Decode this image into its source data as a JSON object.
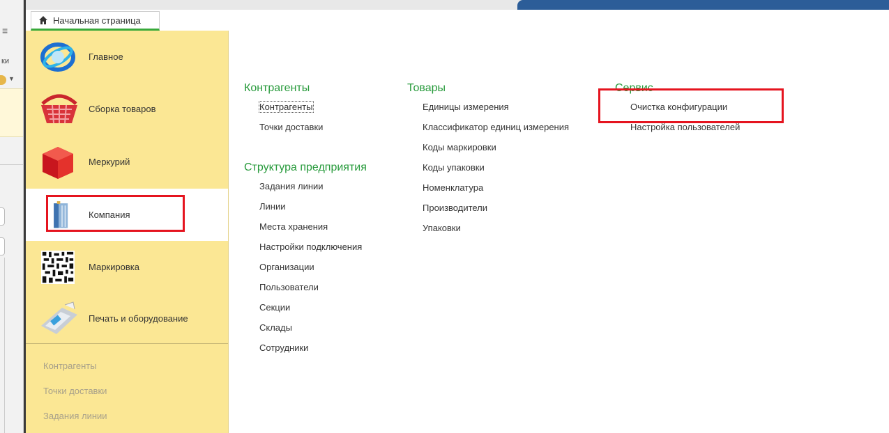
{
  "strip": {
    "menu_glyph": "≡",
    "partial_text": "ки",
    "caret": "▼"
  },
  "tab": {
    "home_icon": "home-icon",
    "label": "Начальная страница"
  },
  "sidebar": {
    "sections": [
      {
        "label": "Главное",
        "icon": "globe-icon"
      },
      {
        "label": "Сборка товаров",
        "icon": "basket-icon"
      },
      {
        "label": "Меркурий",
        "icon": "red-cube-icon"
      },
      {
        "label": "Компания",
        "icon": "building-icon"
      },
      {
        "label": "Маркировка",
        "icon": "qr-code-icon"
      },
      {
        "label": "Печать и оборудование",
        "icon": "pos-terminal-icon"
      }
    ],
    "quick_links": [
      "Контрагенты",
      "Точки доставки",
      "Задания линии"
    ]
  },
  "content": {
    "kontragenty": {
      "title": "Контрагенты",
      "items": [
        "Контрагенты",
        "Точки доставки"
      ]
    },
    "struktura": {
      "title": "Структура предприятия",
      "items": [
        "Задания линии",
        "Линии",
        "Места хранения",
        "Настройки подключения",
        "Организации",
        "Пользователи",
        "Секции",
        "Склады",
        "Сотрудники"
      ]
    },
    "tovary": {
      "title": "Товары",
      "items": [
        "Единицы измерения",
        "Классификатор единиц измерения",
        "Коды маркировки",
        "Коды упаковки",
        "Номенклатура",
        "Производители",
        "Упаковки"
      ]
    },
    "servis": {
      "title": "Сервис",
      "items": [
        "Очистка конфигурации",
        "Настройка пользователей"
      ]
    }
  },
  "colors": {
    "sidebar_bg": "#fbe794",
    "section_title": "#279a3b",
    "highlight": "#e5141f",
    "tab_underline": "#38a93a"
  }
}
